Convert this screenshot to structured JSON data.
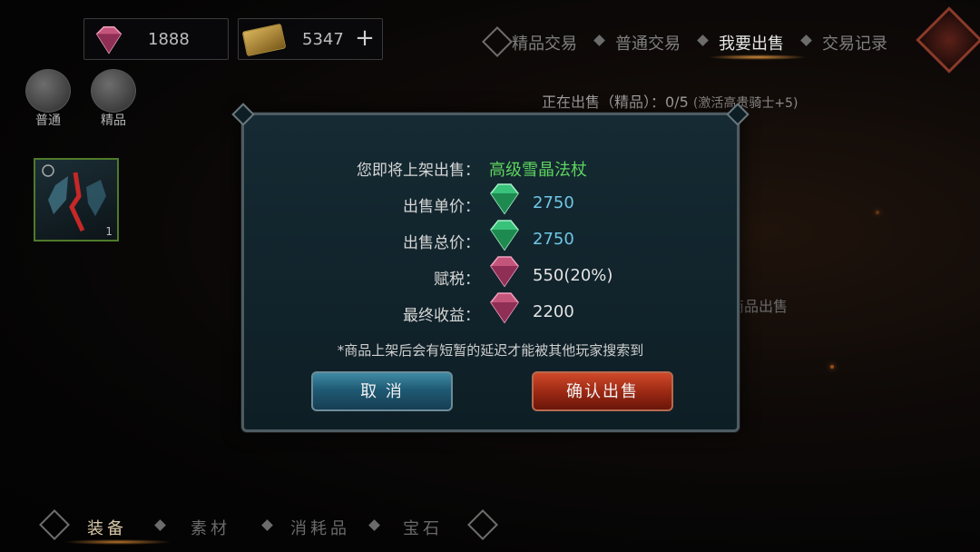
{
  "currencies": {
    "red_gem": {
      "value": "1888",
      "icon": "red-gem-icon"
    },
    "ticket": {
      "value": "5347",
      "icon": "gold-ticket-icon",
      "add_label": "+"
    }
  },
  "top_tabs": [
    {
      "label": "精品交易",
      "active": false
    },
    {
      "label": "普通交易",
      "active": false
    },
    {
      "label": "我要出售",
      "active": true
    },
    {
      "label": "交易记录",
      "active": false
    }
  ],
  "filters": [
    {
      "label": "普通",
      "icon": "helmet-icon"
    },
    {
      "label": "精品",
      "icon": "hands-sparkle-icon"
    }
  ],
  "item_slot": {
    "count": "1",
    "icon": "staff-icon"
  },
  "selling_status": {
    "text": "正在出售（精品）：0/5",
    "note": "(激活高贵骑士+5)"
  },
  "empty_message": "暂无商品出售",
  "bottom_tabs": [
    {
      "label": "装备",
      "active": true
    },
    {
      "label": "素材",
      "active": false
    },
    {
      "label": "消耗品",
      "active": false
    },
    {
      "label": "宝石",
      "active": false
    }
  ],
  "dialog": {
    "item_label": "您即将上架出售：",
    "item_name": "高级雪晶法杖",
    "unit_price_label": "出售单价：",
    "unit_price": "2750",
    "total_price_label": "出售总价：",
    "total_price": "2750",
    "tax_label": "赋税：",
    "tax": "550(20%)",
    "final_label": "最终收益：",
    "final": "2200",
    "note": "*商品上架后会有短暂的延迟才能被其他玩家搜索到",
    "cancel_label": "取 消",
    "confirm_label": "确认出售"
  },
  "colors": {
    "item_name": "#5ed45e",
    "price": "#6fc6e6",
    "cancel_button": "#2a6f8c",
    "confirm_button": "#b03a1e"
  }
}
